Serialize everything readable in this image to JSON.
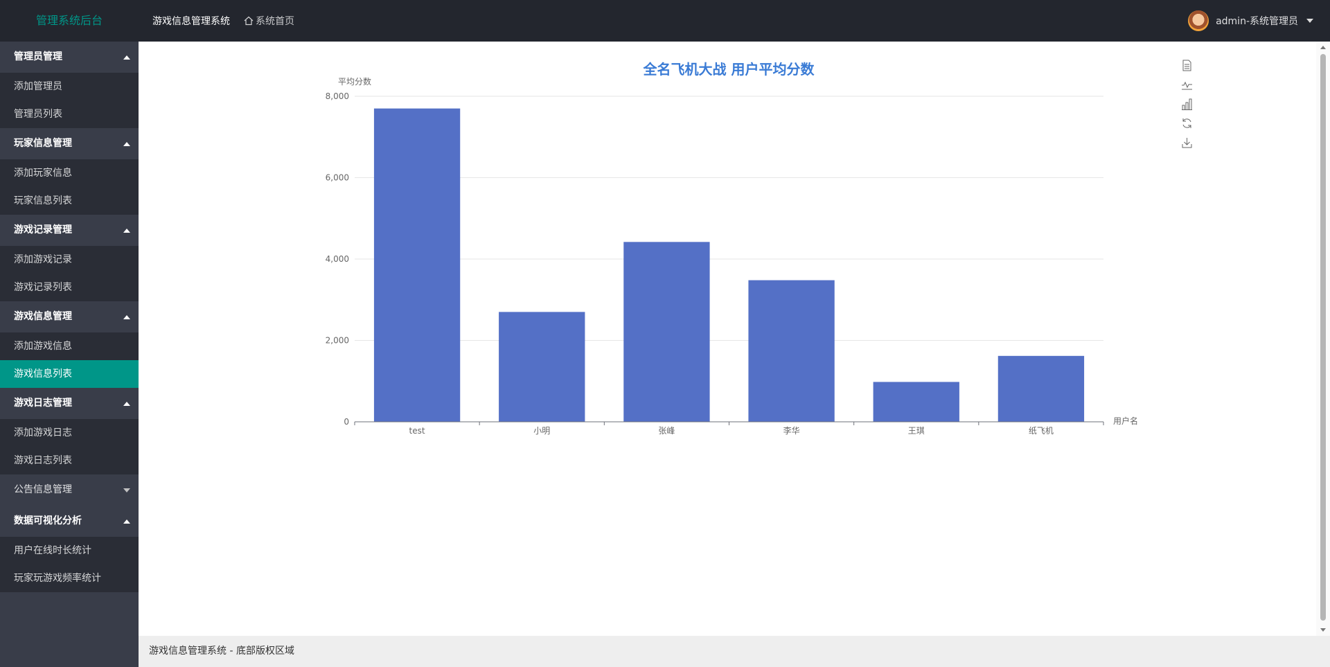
{
  "header": {
    "logo": "管理系统后台",
    "nav": [
      {
        "label": "游戏信息管理系统"
      },
      {
        "label": "系统首页"
      }
    ],
    "user_label": "admin-系统管理员"
  },
  "sidebar": {
    "groups": [
      {
        "title": "管理员管理",
        "expanded": true,
        "items": [
          {
            "label": "添加管理员"
          },
          {
            "label": "管理员列表"
          }
        ]
      },
      {
        "title": "玩家信息管理",
        "expanded": true,
        "items": [
          {
            "label": "添加玩家信息"
          },
          {
            "label": "玩家信息列表"
          }
        ]
      },
      {
        "title": "游戏记录管理",
        "expanded": true,
        "items": [
          {
            "label": "添加游戏记录"
          },
          {
            "label": "游戏记录列表"
          }
        ]
      },
      {
        "title": "游戏信息管理",
        "expanded": true,
        "items": [
          {
            "label": "添加游戏信息"
          },
          {
            "label": "游戏信息列表",
            "active": true
          }
        ]
      },
      {
        "title": "游戏日志管理",
        "expanded": true,
        "items": [
          {
            "label": "添加游戏日志"
          },
          {
            "label": "游戏日志列表"
          }
        ]
      },
      {
        "title": "公告信息管理",
        "expanded": false,
        "items": []
      },
      {
        "title": "数据可视化分析",
        "expanded": true,
        "items": [
          {
            "label": "用户在线时长统计"
          },
          {
            "label": "玩家玩游戏频率统计"
          }
        ]
      }
    ]
  },
  "toolbox": {
    "icons": [
      "data-view-icon",
      "line-chart-icon",
      "bar-chart-icon",
      "restore-icon",
      "download-icon"
    ]
  },
  "footer": {
    "text": "游戏信息管理系统 - 底部版权区域"
  },
  "chart_data": {
    "type": "bar",
    "title": "全名飞机大战 用户平均分数",
    "ylabel": "平均分数",
    "xlabel": "用户名",
    "categories": [
      "test",
      "小明",
      "张峰",
      "李华",
      "王琪",
      "纸飞机"
    ],
    "values": [
      7700,
      2700,
      4420,
      3480,
      980,
      1620
    ],
    "ylim": [
      0,
      8000
    ],
    "yticks": [
      0,
      2000,
      4000,
      6000,
      8000
    ],
    "ytick_labels": [
      "0",
      "2,000",
      "4,000",
      "6,000",
      "8,000"
    ],
    "bar_color": "#5470c6",
    "title_color": "#3a7bd5",
    "grid": true
  }
}
